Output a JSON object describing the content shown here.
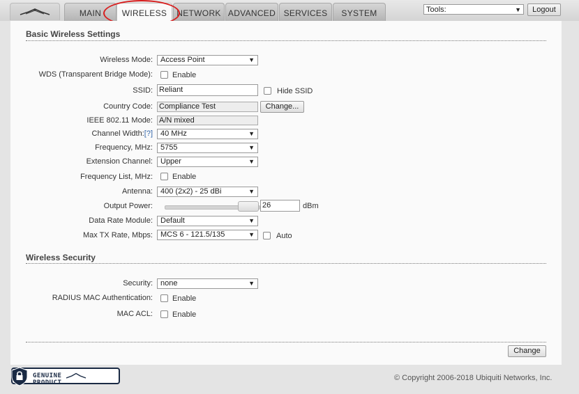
{
  "nav": {
    "tabs": [
      {
        "label": "MAIN"
      },
      {
        "label": "WIRELESS"
      },
      {
        "label": "NETWORK"
      },
      {
        "label": "ADVANCED"
      },
      {
        "label": "SERVICES"
      },
      {
        "label": "SYSTEM"
      }
    ],
    "active_tab": "WIRELESS",
    "tools_value": "Tools:",
    "logout_label": "Logout"
  },
  "basic": {
    "title": "Basic Wireless Settings",
    "wireless_mode": {
      "label": "Wireless Mode:",
      "value": "Access Point"
    },
    "wds": {
      "label": "WDS (Transparent Bridge Mode):",
      "checkbox_label": "Enable",
      "checked": false
    },
    "ssid": {
      "label": "SSID:",
      "value": "Reliant",
      "hide_label": "Hide SSID",
      "hide_checked": false
    },
    "country": {
      "label": "Country Code:",
      "value": "Compliance Test",
      "button": "Change..."
    },
    "ieee": {
      "label": "IEEE 802.11 Mode:",
      "value": "A/N mixed"
    },
    "channel_width": {
      "label": "Channel Width:",
      "help": "[?]",
      "value": "40 MHz"
    },
    "frequency": {
      "label": "Frequency, MHz:",
      "value": "5755"
    },
    "extension": {
      "label": "Extension Channel:",
      "value": "Upper"
    },
    "freq_list": {
      "label": "Frequency List, MHz:",
      "checkbox_label": "Enable",
      "checked": false
    },
    "antenna": {
      "label": "Antenna:",
      "value": "400 (2x2) - 25 dBi"
    },
    "output_power": {
      "label": "Output Power:",
      "value": "26",
      "unit": "dBm"
    },
    "data_rate": {
      "label": "Data Rate Module:",
      "value": "Default"
    },
    "max_tx": {
      "label": "Max TX Rate, Mbps:",
      "value": "MCS 6 - 121.5/135",
      "auto_label": "Auto",
      "auto_checked": false
    }
  },
  "security": {
    "title": "Wireless Security",
    "security": {
      "label": "Security:",
      "value": "none"
    },
    "radius": {
      "label": "RADIUS MAC Authentication:",
      "checkbox_label": "Enable",
      "checked": false
    },
    "mac_acl": {
      "label": "MAC ACL:",
      "checkbox_label": "Enable",
      "checked": false
    }
  },
  "change_button": "Change",
  "footer": {
    "copyright": "© Copyright 2006-2018 Ubiquiti Networks, Inc.",
    "badge_text": "GENUINE",
    "badge_text2": "PRODUCT"
  },
  "colors": {
    "highlight": "#d81e1e",
    "badge": "#1a2a44",
    "help_link": "#3366aa"
  },
  "icons": [
    "ubiquiti-logo-icon",
    "chevron-down-icon",
    "lock-shield-icon"
  ]
}
